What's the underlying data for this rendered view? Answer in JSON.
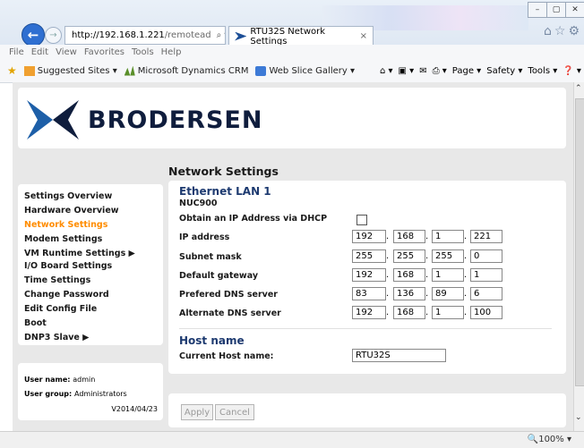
{
  "browser": {
    "address_host": "http://192.168.1.221",
    "address_path": "/remotead",
    "address_controls": "⌕ ▾ ↻",
    "tab_title": "RTU32S Network Settings",
    "tab_close": "×",
    "window_buttons": [
      "–",
      "▢",
      "✕"
    ],
    "toolbar_icons": "⌂☆⚙",
    "menu": [
      "File",
      "Edit",
      "View",
      "Favorites",
      "Tools",
      "Help"
    ],
    "favorites": [
      {
        "label": "Suggested Sites ▾",
        "icon": "suggested-sites-icon",
        "color": "#f0a030"
      },
      {
        "label": "Microsoft Dynamics CRM",
        "icon": "crm-icon",
        "color": "#5a8f2a"
      },
      {
        "label": "Web Slice Gallery ▾",
        "icon": "web-slice-icon",
        "color": "#3d7ad6"
      }
    ],
    "commands": [
      "⌂ ▾",
      "▣ ▾",
      "✉",
      "⎙ ▾",
      "Page ▾",
      "Safety ▾",
      "Tools ▾",
      "❓ ▾"
    ],
    "zoom": "🔍100%  ▾"
  },
  "logo": {
    "text": "BRODERSEN"
  },
  "nav": {
    "items": [
      {
        "label": "Settings Overview",
        "active": false
      },
      {
        "label": "Hardware Overview",
        "active": false
      },
      {
        "label": "Network Settings",
        "active": true
      },
      {
        "label": "Modem Settings",
        "active": false
      },
      {
        "label": "VM Runtime Settings ▶",
        "active": false
      },
      {
        "label": "I/O Board Settings",
        "active": false
      },
      {
        "label": "Time Settings",
        "active": false
      },
      {
        "label": "Change Password",
        "active": false
      },
      {
        "label": "Edit Config File",
        "active": false
      },
      {
        "label": "Boot",
        "active": false
      },
      {
        "label": "DNP3 Slave ▶",
        "active": false
      }
    ]
  },
  "user": {
    "name_label": "User name:",
    "name": "admin",
    "group_label": "User group:",
    "group": "Administrators",
    "version": "V2014/04/23"
  },
  "main": {
    "title": "Network Settings",
    "ethernet_title": "Ethernet LAN 1",
    "device": "NUC900",
    "dhcp_label": "Obtain an IP Address via DHCP",
    "fields": [
      {
        "label": "IP address",
        "octets": [
          "192",
          "168",
          "1",
          "221"
        ]
      },
      {
        "label": "Subnet mask",
        "octets": [
          "255",
          "255",
          "255",
          "0"
        ]
      },
      {
        "label": "Default gateway",
        "octets": [
          "192",
          "168",
          "1",
          "1"
        ]
      },
      {
        "label": "Prefered DNS server",
        "octets": [
          "83",
          "136",
          "89",
          "6"
        ]
      },
      {
        "label": "Alternate DNS server",
        "octets": [
          "192",
          "168",
          "1",
          "100"
        ]
      }
    ],
    "host_title": "Host name",
    "host_label": "Current Host name:",
    "host_value": "RTU32S"
  },
  "buttons": {
    "apply": "Apply",
    "cancel": "Cancel"
  },
  "colors": {
    "accent": "#ff8c00",
    "brand": "#0f1d3d",
    "section": "#1d3a70",
    "address_blue": "#2f6fd1"
  }
}
